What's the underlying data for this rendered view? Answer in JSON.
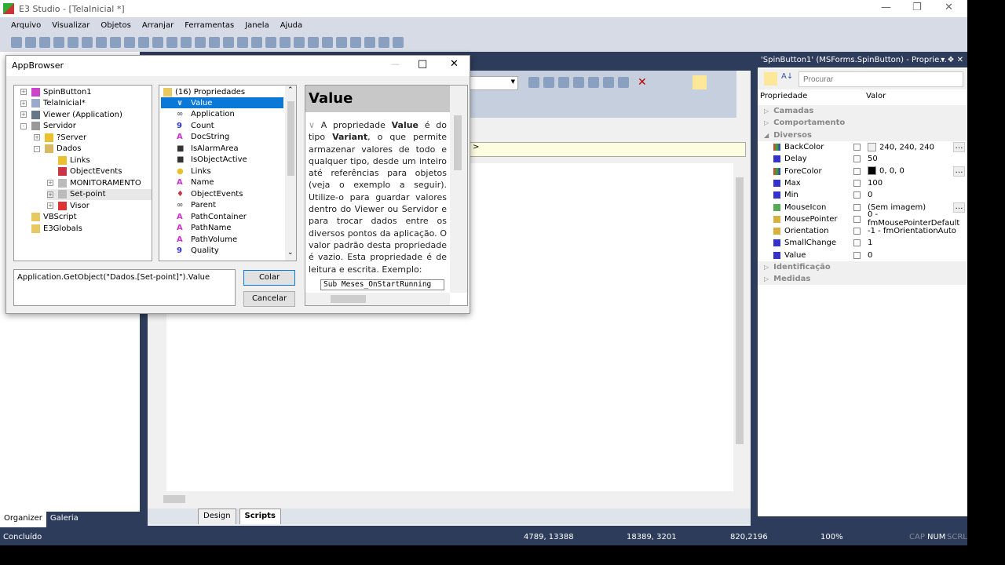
{
  "window": {
    "title": "E3 Studio - [TelaInicial *]"
  },
  "menu": [
    "Arquivo",
    "Visualizar",
    "Objetos",
    "Arranjar",
    "Ferramentas",
    "Janela",
    "Ajuda"
  ],
  "dialog": {
    "title": "AppBrowser",
    "tree": [
      {
        "label": "SpinButton1",
        "level": 0,
        "expander": "+",
        "icon": "spinbutton-icon"
      },
      {
        "label": "TelaInicial*",
        "level": 0,
        "expander": "+",
        "icon": "screen-icon"
      },
      {
        "label": "Viewer (Application)",
        "level": 0,
        "expander": "+",
        "icon": "viewer-icon"
      },
      {
        "label": "Servidor",
        "level": 0,
        "expander": "-",
        "icon": "server-icon"
      },
      {
        "label": "?Server",
        "level": 1,
        "expander": "+",
        "icon": "server-ball-icon"
      },
      {
        "label": "Dados",
        "level": 1,
        "expander": "-",
        "icon": "folder-data-icon"
      },
      {
        "label": "Links",
        "level": 2,
        "expander": "",
        "icon": "links-icon"
      },
      {
        "label": "ObjectEvents",
        "level": 2,
        "expander": "",
        "icon": "events-icon"
      },
      {
        "label": "MONITORAMENTO",
        "level": 2,
        "expander": "+",
        "icon": "tag-icon"
      },
      {
        "label": "Set-point",
        "level": 2,
        "expander": "+",
        "icon": "tag-icon",
        "highlighted": true
      },
      {
        "label": "Visor",
        "level": 2,
        "expander": "+",
        "icon": "trend-icon"
      },
      {
        "label": "VBScript",
        "level": 0,
        "expander": "",
        "icon": "script-icon"
      },
      {
        "label": "E3Globals",
        "level": 0,
        "expander": "",
        "icon": "script-icon"
      }
    ],
    "properties_header": "(16) Propriedades",
    "properties": [
      {
        "label": "Value",
        "type": "V",
        "selected": true
      },
      {
        "label": "Application",
        "type": "link"
      },
      {
        "label": "Count",
        "type": "9"
      },
      {
        "label": "DocString",
        "type": "A"
      },
      {
        "label": "IsAlarmArea",
        "type": "bool"
      },
      {
        "label": "IsObjectActive",
        "type": "bool"
      },
      {
        "label": "Links",
        "type": "links"
      },
      {
        "label": "Name",
        "type": "A"
      },
      {
        "label": "ObjectEvents",
        "type": "events"
      },
      {
        "label": "Parent",
        "type": "link"
      },
      {
        "label": "PathContainer",
        "type": "A"
      },
      {
        "label": "PathName",
        "type": "A"
      },
      {
        "label": "PathVolume",
        "type": "A"
      },
      {
        "label": "Quality",
        "type": "9"
      }
    ],
    "help_title": "Value",
    "help_parts": {
      "p1": "A propriedade ",
      "b1": "Value",
      "p2": " é do tipo ",
      "b2": "Variant",
      "p3": ", o que permite armazenar valores de todo e qualquer tipo, desde um inteiro até referências para objetos (veja o exemplo a seguir). Utilize-o para guardar valores dentro do Viewer ou Servidor e para trocar dados entre os diversos pontos da aplicação. O valor padrão desta propriedade é vazio. Esta propriedade é de leitura e escrita. Exemplo:"
    },
    "help_code": "Sub Meses_OnStartRunning",
    "expression": "Application.GetObject(\"Dados.[Set-point]\").Value",
    "paste_label": "Colar",
    "cancel_label": "Cancelar"
  },
  "editor": {
    "line_text": ">",
    "tabs": [
      {
        "label": "Design",
        "active": false
      },
      {
        "label": "Scripts",
        "active": true
      }
    ]
  },
  "left_tabs": [
    {
      "label": "Organizer",
      "active": true
    },
    {
      "label": "Galeria",
      "active": false
    }
  ],
  "props_panel": {
    "title": "'SpinButton1' (MSForms.SpinButton) - Proprie...",
    "search_placeholder": "Procurar",
    "col_property": "Propriedade",
    "col_value": "Valor",
    "rows": [
      {
        "cat": "Camadas",
        "expanded": false
      },
      {
        "cat": "Comportamento",
        "expanded": false
      },
      {
        "cat": "Diversos",
        "expanded": true
      },
      {
        "name": "BackColor",
        "value": "240, 240, 240",
        "icon": "color-icon",
        "swatch": "#f0f0f0",
        "ellipsis": true
      },
      {
        "name": "Delay",
        "value": "50",
        "icon": "number-icon"
      },
      {
        "name": "ForeColor",
        "value": "0, 0, 0",
        "icon": "color-icon",
        "swatch": "#000000",
        "ellipsis": true
      },
      {
        "name": "Max",
        "value": "100",
        "icon": "number-icon"
      },
      {
        "name": "Min",
        "value": "0",
        "icon": "number-icon"
      },
      {
        "name": "MouseIcon",
        "value": "(Sem imagem)",
        "icon": "image-icon",
        "ellipsis": true
      },
      {
        "name": "MousePointer",
        "value": "0 - fmMousePointerDefault",
        "icon": "enum-icon"
      },
      {
        "name": "Orientation",
        "value": "-1 - fmOrientationAuto",
        "icon": "enum-icon"
      },
      {
        "name": "SmallChange",
        "value": "1",
        "icon": "number-icon"
      },
      {
        "name": "Value",
        "value": "0",
        "icon": "number-icon"
      },
      {
        "cat": "Identificação",
        "expanded": false
      },
      {
        "cat": "Medidas",
        "expanded": false
      }
    ]
  },
  "status": {
    "text": "Concluído",
    "coord1": "4789, 13388",
    "coord2": "18389, 3201",
    "coord3": "820,2196",
    "zoom": "100%",
    "cap": "CAP",
    "num": "NUM",
    "scrl": "SCRL"
  },
  "colors": {
    "frame": "#2d3c5a",
    "selection": "#0a78d7"
  }
}
